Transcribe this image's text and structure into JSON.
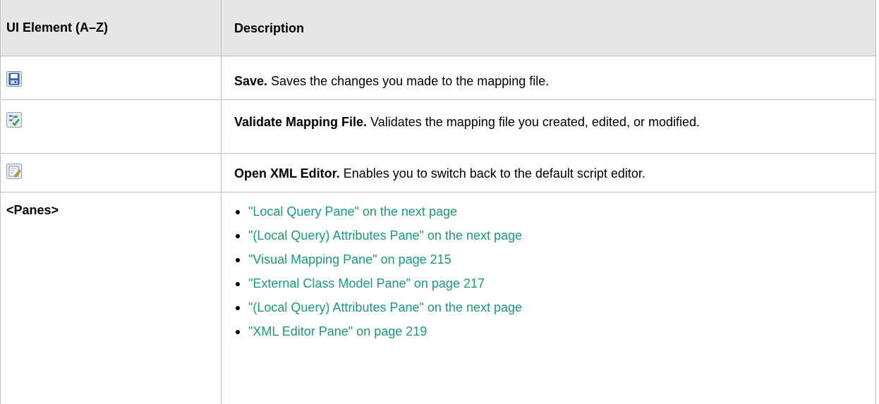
{
  "table": {
    "header": {
      "col1": "UI Element (A–Z)",
      "col2": "Description"
    },
    "rows": [
      {
        "icon": "save-icon",
        "title": "Save.",
        "text": " Saves the changes you made to the mapping file."
      },
      {
        "icon": "validate-mapping-icon",
        "title": "Validate Mapping File.",
        "text": " Validates the mapping file you created, edited, or modified."
      },
      {
        "icon": "open-xml-editor-icon",
        "title": "Open XML Editor.",
        "text": " Enables you to switch back to the default script editor."
      }
    ],
    "panes": {
      "label": "<Panes>",
      "links": [
        "\"Local Query Pane\" on the next page",
        "\"(Local Query) Attributes Pane\" on the next page",
        "\"Visual Mapping Pane\" on page 215",
        "\"External Class Model Pane\" on page 217",
        "\"(Local Query) Attributes Pane\" on the next page",
        "\"XML Editor Pane\" on page 219"
      ]
    }
  },
  "colors": {
    "link": "#1a9a76",
    "header_bg": "#e6e6e6",
    "border": "#c0c0c0"
  }
}
